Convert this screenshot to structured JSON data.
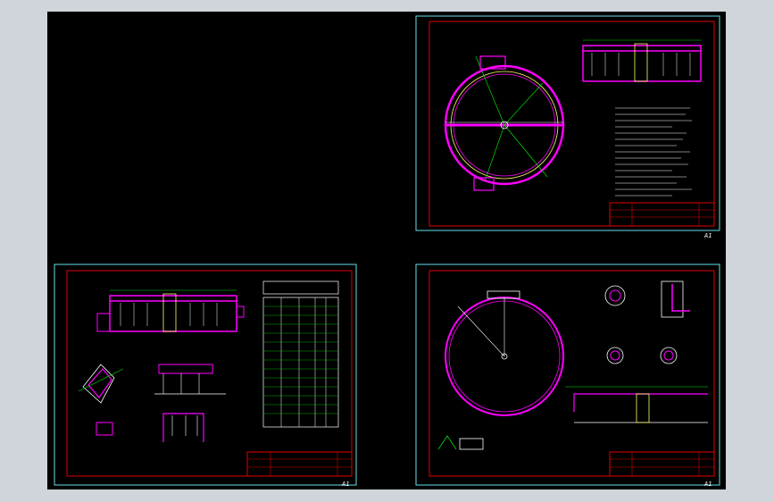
{
  "viewport": {
    "background": "#d0d5dc",
    "canvas_background": "#000000"
  },
  "colors": {
    "sheet_border": "#66e0e8",
    "frame": "#e00000",
    "structure": "#ff00ff",
    "dimension": "#00e000",
    "text": "#ffffff",
    "hatch": "#ffff66"
  },
  "sheets": [
    {
      "id": "top-right",
      "label": "A1"
    },
    {
      "id": "bottom-left",
      "label": "A1"
    },
    {
      "id": "bottom-right",
      "label": "A1"
    }
  ]
}
